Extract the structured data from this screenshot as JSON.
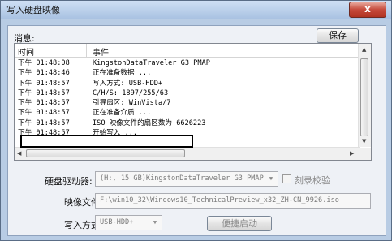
{
  "window": {
    "title": "写入硬盘映像",
    "close_label": "x"
  },
  "messages": {
    "label": "消息:",
    "save_label": "保存",
    "col_time": "时间",
    "col_event": "事件",
    "rows": [
      {
        "time": "下午 01:48:08",
        "event": "KingstonDataTraveler G3 PMAP"
      },
      {
        "time": "下午 01:48:46",
        "event": "正在准备数据 ..."
      },
      {
        "time": "下午 01:48:57",
        "event": "写入方式: USB-HDD+"
      },
      {
        "time": "下午 01:48:57",
        "event": "C/H/S: 1897/255/63"
      },
      {
        "time": "下午 01:48:57",
        "event": "引导扇区: WinVista/7"
      },
      {
        "time": "下午 01:48:57",
        "event": "正在准备介质 ..."
      },
      {
        "time": "下午 01:48:57",
        "event": "ISO 映像文件的扇区数为 6626223"
      },
      {
        "time": "下午 01:48:57",
        "event": "开始写入 ..."
      }
    ]
  },
  "form": {
    "drive_label": "硬盘驱动器:",
    "drive_value": "(H:, 15 GB)KingstonDataTraveler G3 PMAP",
    "verify_label": "刻录校验",
    "image_label": "映像文件:",
    "image_value": "F:\\win10_32\\Windows10_TechnicalPreview_x32_ZH-CN_9926.iso",
    "method_label": "写入方式:",
    "method_value": "USB-HDD+",
    "boot_label": "便捷启动"
  }
}
